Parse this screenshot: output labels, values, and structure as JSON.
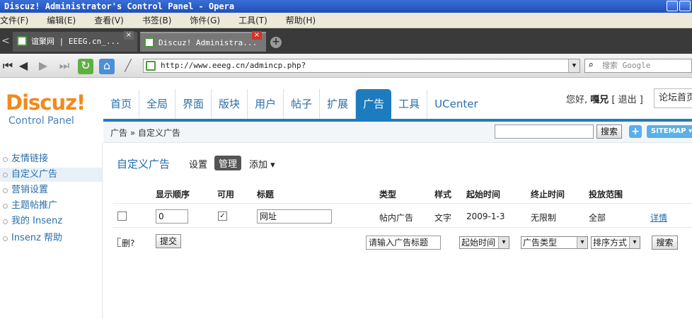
{
  "window": {
    "title": "Discuz! Administrator's Control Panel - Opera"
  },
  "menu": [
    "文件(F)",
    "编辑(E)",
    "查看(V)",
    "书签(B)",
    "饰件(G)",
    "工具(T)",
    "帮助(H)"
  ],
  "tabs": [
    {
      "label": "谊聚网 | EEEG.cn_..."
    },
    {
      "label": "Discuz! Administra..."
    }
  ],
  "address": {
    "url": "http://www.eeeg.cn/admincp.php?",
    "search_placeholder": "搜索 Google"
  },
  "logo": {
    "brand": "Discuz!",
    "sub": "Control Panel"
  },
  "nav": [
    "首页",
    "全局",
    "界面",
    "版块",
    "用户",
    "帖子",
    "扩展",
    "广告",
    "工具",
    "UCenter"
  ],
  "nav_active": "广告",
  "user": {
    "greeting": "您好,",
    "name": "嘎兄",
    "logout": "[ 退出 ]",
    "forum_home": "论坛首页"
  },
  "crumb": "广告 » 自定义广告",
  "top_search_button": "搜索",
  "plus_label": "+",
  "sitemap_label": "SITEMAP",
  "sidebar": [
    "友情链接",
    "自定义广告",
    "营销设置",
    "主题帖推广",
    "我的 Insenz",
    "Insenz 帮助"
  ],
  "page": {
    "title": "自定义广告",
    "tabs": {
      "settings": "设置",
      "manage": "管理",
      "add": "添加 ▾"
    }
  },
  "table": {
    "headers": [
      "显示顺序",
      "可用",
      "标题",
      "类型",
      "样式",
      "起始时间",
      "终止时间",
      "投放范围"
    ],
    "row": {
      "order": "0",
      "enabled_mark": "✓",
      "title": "网址",
      "type": "帖内广告",
      "style": "文字",
      "start": "2009-1-3",
      "end": "无限制",
      "scope": "全部",
      "detail": "详情"
    }
  },
  "footer": {
    "delete_label": "删?",
    "submit": "提交",
    "title_placeholder": "请输入广告标题",
    "start_select": "起始时间",
    "type_select": "广告类型",
    "sort_select": "排序方式",
    "search": "搜索"
  }
}
